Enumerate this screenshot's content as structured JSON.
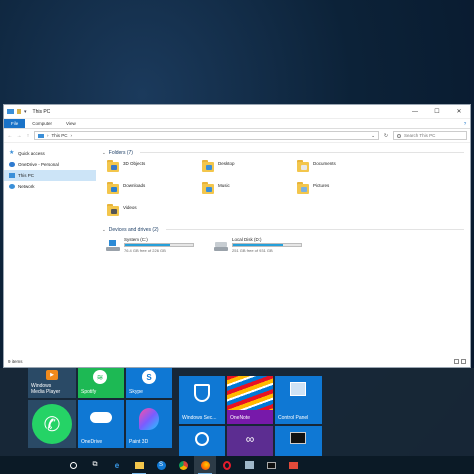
{
  "explorer": {
    "title": "This PC",
    "quick_access_arrow": "▾",
    "window_buttons": [
      "—",
      "☐",
      "✕"
    ],
    "ribbon": {
      "file": "File",
      "computer": "Computer",
      "view": "View",
      "help": "?"
    },
    "nav": {
      "back": "←",
      "forward": "→",
      "up": "↑"
    },
    "address": {
      "path": "This PC",
      "sep": "›",
      "dropdown": "⌄",
      "refresh": "↻"
    },
    "search_placeholder": "Search This PC",
    "nav_pane": [
      {
        "label": "Quick access",
        "icon": "star-icon"
      },
      {
        "label": "OneDrive - Personal",
        "icon": "cloud-icon"
      },
      {
        "label": "This PC",
        "icon": "pc-icon",
        "selected": true
      },
      {
        "label": "Network",
        "icon": "network-icon"
      }
    ],
    "folders_header": "Folders (7)",
    "folders": [
      {
        "label": "3D Objects",
        "icon": "3d-objects-folder-icon",
        "glyph": "#3a78c8"
      },
      {
        "label": "Desktop",
        "icon": "desktop-folder-icon",
        "glyph": "#3a8fd8"
      },
      {
        "label": "Documents",
        "icon": "documents-folder-icon",
        "glyph": "#e8e8e8"
      },
      {
        "label": "Downloads",
        "icon": "downloads-folder-icon",
        "glyph": "#2b7fd0"
      },
      {
        "label": "Music",
        "icon": "music-folder-icon",
        "glyph": "#3a8fd8"
      },
      {
        "label": "Pictures",
        "icon": "pictures-folder-icon",
        "glyph": "#7ab0e0"
      },
      {
        "label": "Videos",
        "icon": "videos-folder-icon",
        "glyph": "#555"
      }
    ],
    "drives_header": "Devices and drives (2)",
    "drives": [
      {
        "name": "System (C:)",
        "free": "76.4 GB free of 226 GB",
        "used_fraction": 0.66,
        "icon": "system-drive-icon"
      },
      {
        "name": "Local Disk (D:)",
        "free": "251 GB free of 931 GB",
        "used_fraction": 0.73,
        "icon": "local-disk-icon"
      }
    ],
    "status": "9 items"
  },
  "tiles": {
    "media_player": "Windows\nMedia Player",
    "spotify": "Spotify",
    "skype": "Skype",
    "onedrive": "OneDrive",
    "paint3d": "Paint 3D",
    "windows_security": "Windows Sec...",
    "onenote": "OneNote",
    "control_panel": "Control Panel"
  },
  "colors": {
    "accent": "#1a73c8",
    "tile_blue": "#0f78d4",
    "spotify_green": "#1db954",
    "whatsapp_green": "#25d366"
  }
}
